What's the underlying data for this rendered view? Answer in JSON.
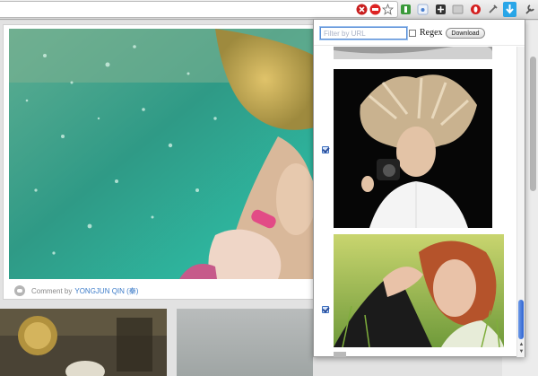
{
  "popup": {
    "filter": {
      "placeholder": "Filter by URL",
      "value": ""
    },
    "regex_label": "Regex",
    "download_label": "Download",
    "items": [
      {
        "name": "top-partial-image",
        "checked": false
      },
      {
        "name": "blonde-woman-camera-image",
        "checked": true
      },
      {
        "name": "redhead-woman-grass-image",
        "checked": true
      }
    ]
  },
  "page": {
    "comment": {
      "prefix": "Comment by",
      "author": "YONGJUN QIN (秦)"
    }
  },
  "toolbar": {
    "icons": [
      "stop-icon",
      "abp-icon",
      "star-icon",
      "extension-icon",
      "blank-icon",
      "gear-ext-icon",
      "puzzle-icon",
      "opera-icon",
      "tools-icon",
      "download-ext-icon",
      "wrench-icon"
    ]
  },
  "colors": {
    "accent": "#3d7cc9",
    "scroll": "#2c62d0",
    "download_ext": "#29a6e8"
  }
}
